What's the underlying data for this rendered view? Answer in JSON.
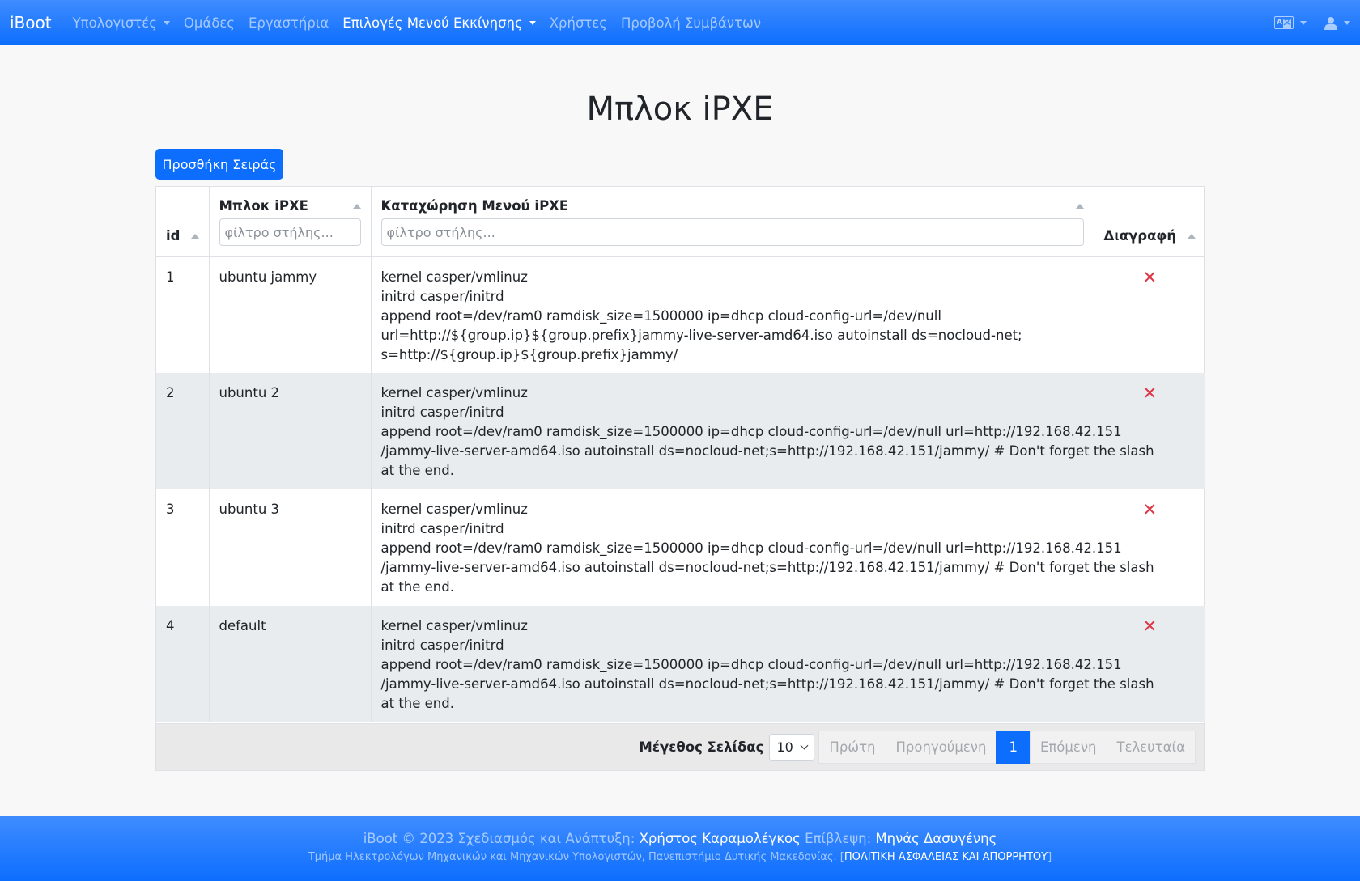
{
  "navbar": {
    "brand": "iBoot",
    "items": [
      {
        "label": "Υπολογιστές"
      },
      {
        "label": "Ομάδες"
      },
      {
        "label": "Εργαστήρια"
      },
      {
        "label": "Επιλογές Μενού Εκκίνησης"
      },
      {
        "label": "Χρήστες"
      },
      {
        "label": "Προβολή Συμβάντων"
      }
    ],
    "lang_icon_letters": [
      "A",
      "文"
    ]
  },
  "page": {
    "title": "Μπλοκ iPXE",
    "add_row_label": "Προσθήκη Σειράς"
  },
  "table": {
    "headers": {
      "id": "id",
      "block": "Μπλοκ iPXE",
      "entry": "Καταχώρηση Μενού iPXE",
      "delete": "Διαγραφή"
    },
    "filter_placeholder": "φίλτρο στήλης...",
    "delete_glyph": "✕",
    "rows": [
      {
        "id": "1",
        "block": "ubuntu jammy",
        "entry": [
          "kernel casper/vmlinuz",
          "initrd casper/initrd",
          "append root=/dev/ram0 ramdisk_size=1500000 ip=dhcp cloud-config-url=/dev/null",
          "url=http://${group.ip}${group.prefix}jammy-live-server-amd64.iso autoinstall ds=nocloud-net;",
          "s=http://${group.ip}${group.prefix}jammy/"
        ]
      },
      {
        "id": "2",
        "block": "ubuntu 2",
        "entry": [
          "kernel casper/vmlinuz",
          "initrd casper/initrd",
          "append root=/dev/ram0 ramdisk_size=1500000 ip=dhcp cloud-config-url=/dev/null url=http://192.168.42.151",
          "/jammy-live-server-amd64.iso autoinstall ds=nocloud-net;s=http://192.168.42.151/jammy/ # Don't forget the slash",
          "at the end."
        ]
      },
      {
        "id": "3",
        "block": "ubuntu 3",
        "entry": [
          "kernel casper/vmlinuz",
          "initrd casper/initrd",
          "append root=/dev/ram0 ramdisk_size=1500000 ip=dhcp cloud-config-url=/dev/null url=http://192.168.42.151",
          "/jammy-live-server-amd64.iso autoinstall ds=nocloud-net;s=http://192.168.42.151/jammy/ # Don't forget the slash",
          "at the end."
        ]
      },
      {
        "id": "4",
        "block": "default",
        "entry": [
          "kernel casper/vmlinuz",
          "initrd casper/initrd",
          "append root=/dev/ram0 ramdisk_size=1500000 ip=dhcp cloud-config-url=/dev/null url=http://192.168.42.151",
          "/jammy-live-server-amd64.iso autoinstall ds=nocloud-net;s=http://192.168.42.151/jammy/ # Don't forget the slash",
          "at the end."
        ]
      }
    ]
  },
  "pagination": {
    "page_size_label": "Μέγεθος Σελίδας",
    "page_size_value": "10",
    "first": "Πρώτη",
    "previous": "Προηγούμενη",
    "current": "1",
    "next": "Επόμενη",
    "last": "Τελευταία"
  },
  "footer": {
    "line1_prefix": "iBoot © 2023 Σχεδιασμός και Ανάπτυξη: ",
    "developer": "Χρήστος Καραμολέγκος",
    "supervision_label": " Επίβλεψη: ",
    "supervisor": "Μηνάς Δασυγένης",
    "line2_dept": "Τμήμα Ηλεκτρολόγων Μηχανικών και Μηχανικών Υπολογιστών, Πανεπιστήμιο Δυτικής Μακεδονίας. ",
    "line2_policy_open": "[",
    "line2_policy": "ΠΟΛΙΤΙΚΗ ΑΣΦΑΛΕΙΑΣ ΚΑΙ ΑΠΟΡΡΗΤΟΥ",
    "line2_policy_close": "]"
  },
  "colors": {
    "navbar": "#0d6efd",
    "primary_button": "#0d6efd",
    "delete_icon": "#dc3545",
    "striped_row": "#e9ecef"
  }
}
